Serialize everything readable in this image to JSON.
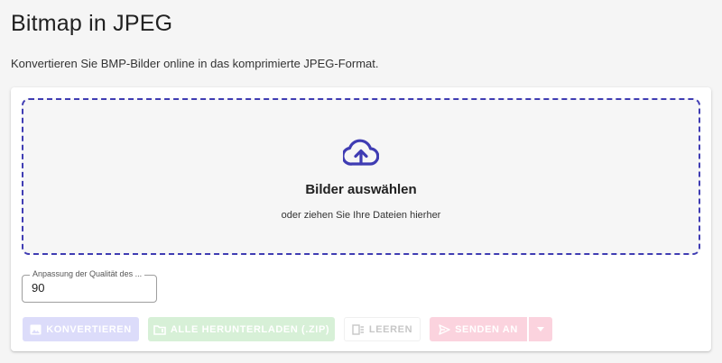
{
  "page": {
    "title": "Bitmap in JPEG",
    "subtitle": "Konvertieren Sie BMP-Bilder online in das komprimierte JPEG-Format."
  },
  "dropzone": {
    "icon": "cloud-upload-icon",
    "title": "Bilder auswählen",
    "subtitle": "oder ziehen Sie Ihre Dateien hierher"
  },
  "quality": {
    "label": "Anpassung der Qualität des ...",
    "value": "90"
  },
  "actions": {
    "convert": {
      "label": "Konvertieren",
      "icon": "image-icon",
      "color": "#dcdcfa"
    },
    "download_all": {
      "label": "Alle herunterladen (.zip)",
      "icon": "folder-zip-icon",
      "color": "#d7f0d7"
    },
    "clear": {
      "label": "Leeren",
      "icon": "clear-list-icon"
    },
    "send_to": {
      "label": "Senden an",
      "icon": "send-icon",
      "color": "#fbd3de"
    },
    "send_menu": {
      "icon": "chevron-down-icon"
    }
  },
  "colors": {
    "accent": "#3f3cb3",
    "background": "#f5f5f5"
  }
}
